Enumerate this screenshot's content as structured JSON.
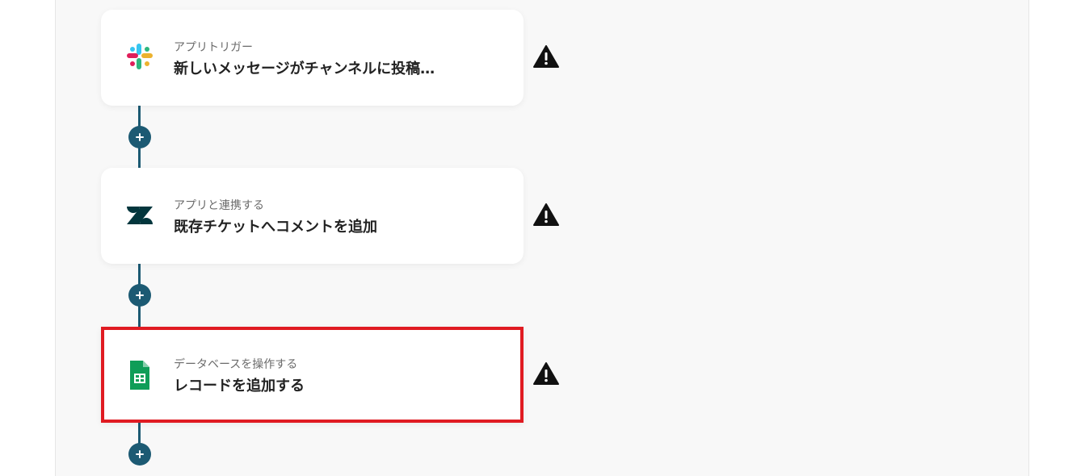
{
  "flow": {
    "steps": [
      {
        "subtitle": "アプリトリガー",
        "title": "新しいメッセージがチャンネルに投稿…",
        "icon": "slack-logo-icon",
        "status_icon": "warning-icon"
      },
      {
        "subtitle": "アプリと連携する",
        "title": "既存チケットへコメントを追加",
        "icon": "zendesk-logo-icon",
        "status_icon": "warning-icon"
      },
      {
        "subtitle": "データベースを操作する",
        "title": "レコードを追加する",
        "icon": "google-sheets-logo-icon",
        "status_icon": "warning-icon",
        "selected": true
      }
    ],
    "add_button_icon": "plus-icon"
  },
  "colors": {
    "connector": "#1c5a73",
    "selection_border": "#e01b22",
    "canvas_bg": "#f8f8f8",
    "warning": "#111111"
  }
}
